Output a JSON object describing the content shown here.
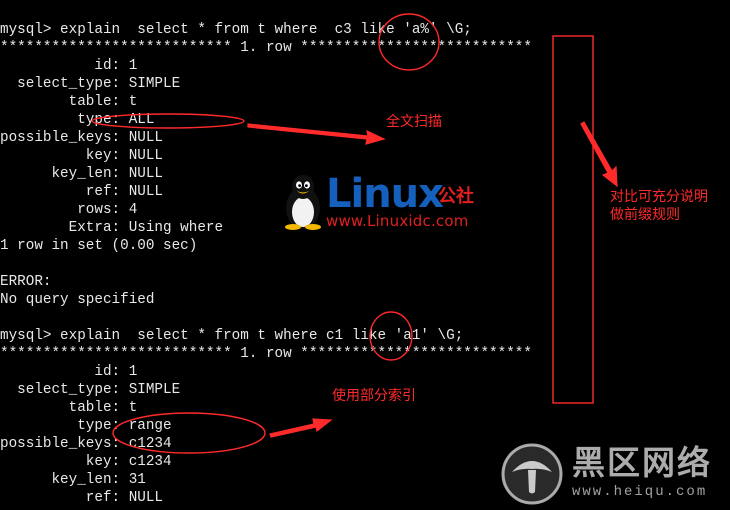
{
  "terminal": {
    "lines": [
      "mysql> explain  select * from t where  c3 like 'a%' \\G;",
      "*************************** 1. row ***************************",
      "           id: 1",
      "  select_type: SIMPLE",
      "        table: t",
      "         type: ALL",
      "possible_keys: NULL",
      "          key: NULL",
      "      key_len: NULL",
      "          ref: NULL",
      "         rows: 4",
      "        Extra: Using where",
      "1 row in set (0.00 sec)",
      "",
      "ERROR:",
      "No query specified",
      "",
      "mysql> explain  select * from t where c1 like 'a1' \\G;",
      "*************************** 1. row ***************************",
      "           id: 1",
      "  select_type: SIMPLE",
      "        table: t",
      "         type: range",
      "possible_keys: c1234",
      "          key: c1234",
      "      key_len: 31",
      "          ref: NULL"
    ]
  },
  "annotations": {
    "full_scan": "全文扫描",
    "compare_line1": "对比可充分说明",
    "compare_line2": "做前缀规则",
    "partial_index": "使用部分索引",
    "color": "#ff2a2a"
  },
  "logo": {
    "word": "Linux",
    "suffix": "公社",
    "url": "www.Linuxidc.com",
    "brand_color": "#1560bd",
    "accent_color": "#e02020"
  },
  "watermark": {
    "word": "黑区网络",
    "url": "www.heiqu.com"
  }
}
